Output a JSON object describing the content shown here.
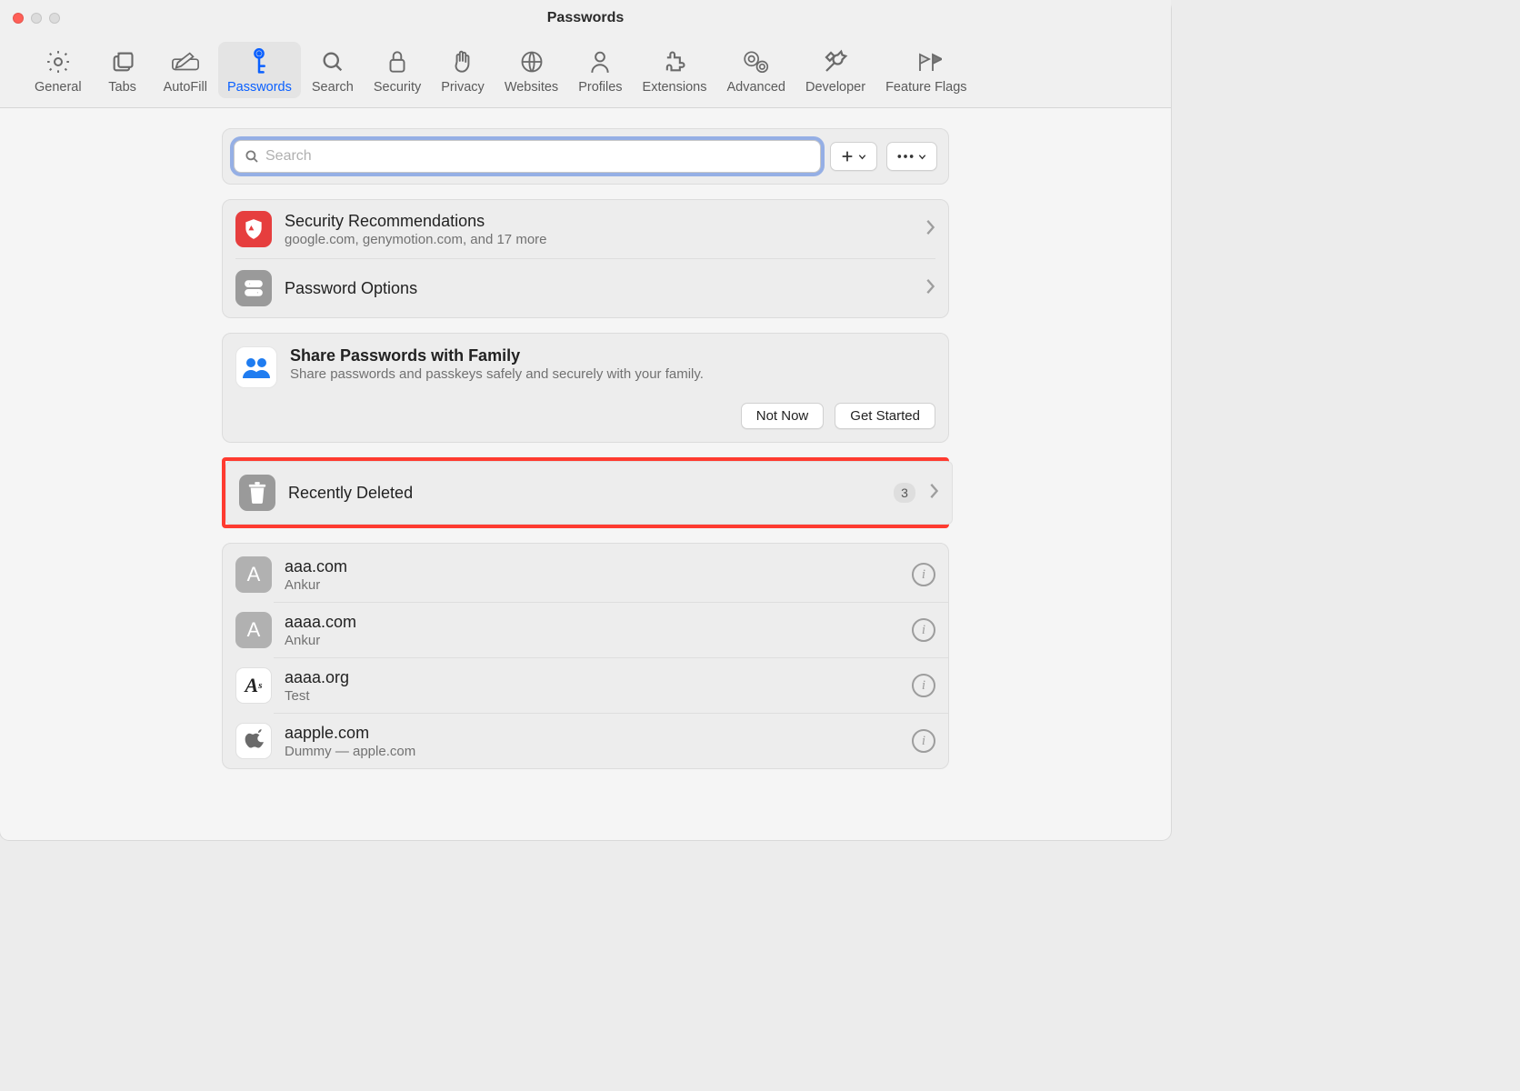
{
  "window": {
    "title": "Passwords"
  },
  "toolbar": {
    "items": [
      {
        "label": "General"
      },
      {
        "label": "Tabs"
      },
      {
        "label": "AutoFill"
      },
      {
        "label": "Passwords"
      },
      {
        "label": "Search"
      },
      {
        "label": "Security"
      },
      {
        "label": "Privacy"
      },
      {
        "label": "Websites"
      },
      {
        "label": "Profiles"
      },
      {
        "label": "Extensions"
      },
      {
        "label": "Advanced"
      },
      {
        "label": "Developer"
      },
      {
        "label": "Feature Flags"
      }
    ],
    "active_index": 3
  },
  "search": {
    "placeholder": "Search",
    "value": ""
  },
  "sections": {
    "security_recs": {
      "title": "Security Recommendations",
      "subtitle": "google.com, genymotion.com, and 17 more"
    },
    "password_options": {
      "title": "Password Options"
    },
    "share_family": {
      "title": "Share Passwords with Family",
      "subtitle": "Share passwords and passkeys safely and securely with your family.",
      "not_now": "Not Now",
      "get_started": "Get Started"
    },
    "recently_deleted": {
      "title": "Recently Deleted",
      "count": "3"
    }
  },
  "passwords": [
    {
      "site": "aaa.com",
      "user": "Ankur",
      "letter": "A",
      "icon": "letter"
    },
    {
      "site": "aaaa.com",
      "user": "Ankur",
      "letter": "A",
      "icon": "letter"
    },
    {
      "site": "aaaa.org",
      "user": "Test",
      "letter": "A",
      "icon": "fancy-a"
    },
    {
      "site": "aapple.com",
      "user": "Dummy — apple.com",
      "letter": "",
      "icon": "apple"
    }
  ]
}
